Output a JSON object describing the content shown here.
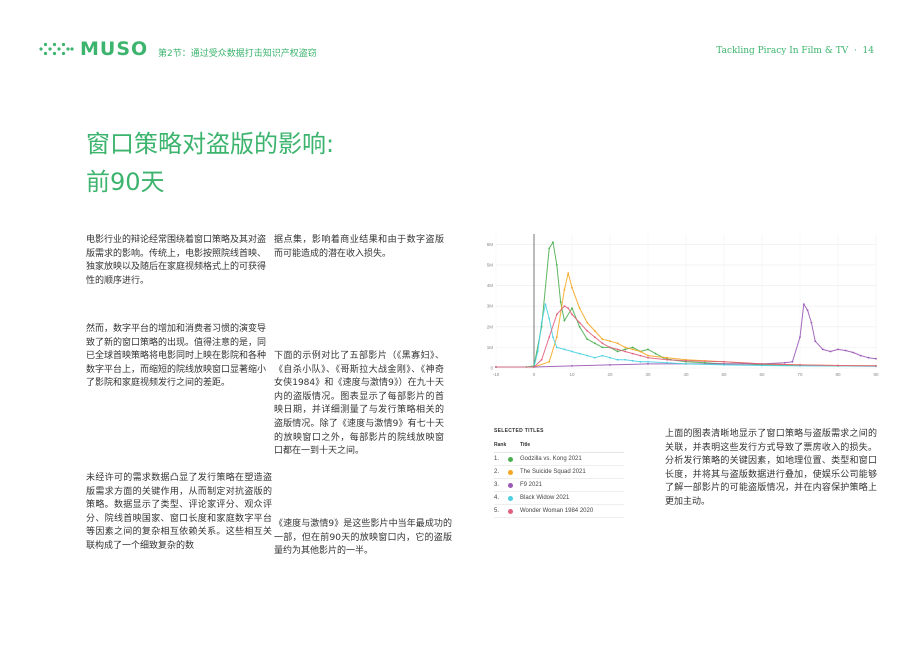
{
  "header": {
    "brand": "MUSO",
    "chapter": "第2节：通过受众数据打击知识产权盗窃",
    "running_title": "Tackling Piracy In Film & TV",
    "page_number": "14",
    "accent_color": "#3cb46e"
  },
  "title": {
    "line1": "窗口策略对盗版的影响:",
    "line2": "前90天"
  },
  "paragraphs": {
    "p1": "电影行业的辩论经常围绕着窗口策略及其对盗版需求的影响。传统上，电影按照院线首映、独家放映以及随后在家庭视频格式上的可获得性的顺序进行。",
    "p2": "然而，数字平台的增加和消费者习惯的演变导致了新的窗口策略的出现。值得注意的是，同已全球首映策略将电影同时上映在影院和各种数字平台上，而缩短的院线放映窗口显著缩小了影院和家庭视频发行之间的差距。",
    "p3": "未经许可的需求数据凸显了发行策略在塑造盗版需求方面的关键作用，从而制定对抗盗版的策略。数据显示了类型、评论家评分、观众评分、院线首映国家、窗口长度和家庭数字平台等因素之间的复杂相互依赖关系。这些相互关联构成了一个细致复杂的数",
    "p4": "据点集，影响着商业结果和由于数字盗版而可能造成的潜在收入损失。",
    "p5": "下面的示例对比了五部影片（《黑寡妇》、《自杀小队》、《哥斯拉大战金刚》、《神奇女侠1984》和《速度与激情9》）在九十天内的盗版情况。图表显示了每部影片的首映日期，并详细测量了与发行策略相关的盗版情况。除了《速度与激情9》有七十天的放映窗口之外，每部影片的院线放映窗口都在一到十天之间。",
    "p6": "《速度与激情9》是这些影片中当年最成功的一部，但在前90天的放映窗口内，它的盗版量约为其他影片的一半。",
    "p7": "上面的图表清晰地显示了窗口策略与盗版需求之间的关联，并表明这些发行方式导致了票房收入的损失。分析发行策略的关键因素，如地理位置、类型和窗口长度，并将其与盗版数据进行叠加，使娱乐公司能够了解一部影片的可能盗版情况，并在内容保护策略上更加主动。"
  },
  "chart_data": {
    "type": "line",
    "title": "",
    "xlabel": "",
    "ylabel": "",
    "x_ticks": [
      "-10",
      "0",
      "10",
      "20",
      "30",
      "40",
      "50",
      "60",
      "70",
      "80",
      "90"
    ],
    "y_ticks": [
      "0",
      "1M",
      "2M",
      "3M",
      "4M",
      "5M",
      "6M"
    ],
    "xlim": [
      -10,
      90
    ],
    "ylim": [
      0,
      6.5
    ],
    "grid": true,
    "vertical_marker_x": 0,
    "series": [
      {
        "name": "Godzilla vs. Kong 2021",
        "color": "#4caf50",
        "x": [
          -10,
          -2,
          0,
          2,
          4,
          5,
          6,
          7,
          8,
          10,
          12,
          14,
          16,
          18,
          20,
          22,
          24,
          26,
          28,
          30,
          32,
          34,
          36,
          40,
          45,
          50,
          55,
          60,
          70,
          80,
          90
        ],
        "y": [
          0.05,
          0.05,
          0.1,
          2.0,
          5.8,
          6.1,
          5.0,
          3.2,
          2.3,
          2.9,
          2.0,
          1.4,
          1.2,
          1.0,
          1.0,
          0.8,
          0.9,
          1.0,
          0.8,
          0.9,
          0.7,
          0.5,
          0.4,
          0.3,
          0.25,
          0.2,
          0.2,
          0.15,
          0.12,
          0.1,
          0.1
        ]
      },
      {
        "name": "The Suicide Squad 2021",
        "color": "#f5a623",
        "x": [
          -10,
          0,
          4,
          6,
          8,
          9,
          10,
          12,
          14,
          16,
          18,
          20,
          22,
          24,
          26,
          28,
          30,
          35,
          40,
          45,
          50,
          60,
          70,
          80,
          90
        ],
        "y": [
          0.05,
          0.05,
          0.3,
          1.5,
          3.8,
          4.6,
          3.9,
          2.9,
          2.2,
          1.8,
          1.4,
          1.3,
          1.2,
          1.0,
          0.9,
          0.8,
          0.6,
          0.5,
          0.4,
          0.35,
          0.3,
          0.2,
          0.15,
          0.12,
          0.1
        ]
      },
      {
        "name": "F9 2021",
        "color": "#9b59b6",
        "x": [
          -10,
          0,
          10,
          20,
          30,
          40,
          50,
          60,
          66,
          68,
          70,
          71,
          72,
          73,
          74,
          76,
          78,
          80,
          82,
          84,
          86,
          88,
          90
        ],
        "y": [
          0.05,
          0.05,
          0.1,
          0.15,
          0.2,
          0.2,
          0.2,
          0.2,
          0.25,
          0.3,
          1.5,
          3.1,
          2.8,
          2.2,
          1.3,
          0.9,
          0.8,
          0.9,
          0.85,
          0.75,
          0.6,
          0.5,
          0.45
        ]
      },
      {
        "name": "Black Widow 2021",
        "color": "#4dd0e1",
        "x": [
          -10,
          0,
          1,
          2,
          3,
          4,
          5,
          6,
          8,
          10,
          12,
          14,
          16,
          18,
          20,
          22,
          24,
          26,
          28,
          30,
          35,
          40,
          50,
          60,
          70,
          80,
          90
        ],
        "y": [
          0.05,
          0.05,
          0.8,
          2.2,
          3.1,
          2.4,
          1.5,
          1.0,
          0.9,
          0.8,
          0.7,
          0.6,
          0.5,
          0.6,
          0.5,
          0.4,
          0.4,
          0.35,
          0.3,
          0.3,
          0.25,
          0.2,
          0.15,
          0.12,
          0.1,
          0.1,
          0.08
        ]
      },
      {
        "name": "Wonder Woman 1984 2020",
        "color": "#e0607e",
        "x": [
          -10,
          0,
          2,
          4,
          6,
          8,
          9,
          10,
          12,
          14,
          16,
          18,
          20,
          22,
          24,
          26,
          28,
          30,
          35,
          40,
          50,
          60,
          70,
          80,
          90
        ],
        "y": [
          0.05,
          0.05,
          0.4,
          1.5,
          2.6,
          3.0,
          2.9,
          2.6,
          2.2,
          1.8,
          1.5,
          1.2,
          1.0,
          0.9,
          0.8,
          0.7,
          0.6,
          0.5,
          0.4,
          0.35,
          0.3,
          0.2,
          0.15,
          0.12,
          0.1
        ]
      }
    ]
  },
  "legend": {
    "heading": "SELECTED TITLES",
    "col_rank": "Rank",
    "col_title": "Title",
    "rows": [
      {
        "rank": "1.",
        "title": "Godzilla vs. Kong 2021",
        "color": "#4caf50"
      },
      {
        "rank": "2.",
        "title": "The Suicide Squad 2021",
        "color": "#f5a623"
      },
      {
        "rank": "3.",
        "title": "F9 2021",
        "color": "#9b59b6"
      },
      {
        "rank": "4.",
        "title": "Black Widow 2021",
        "color": "#4dd0e1"
      },
      {
        "rank": "5.",
        "title": "Wonder Woman 1984 2020",
        "color": "#e0607e"
      }
    ]
  }
}
